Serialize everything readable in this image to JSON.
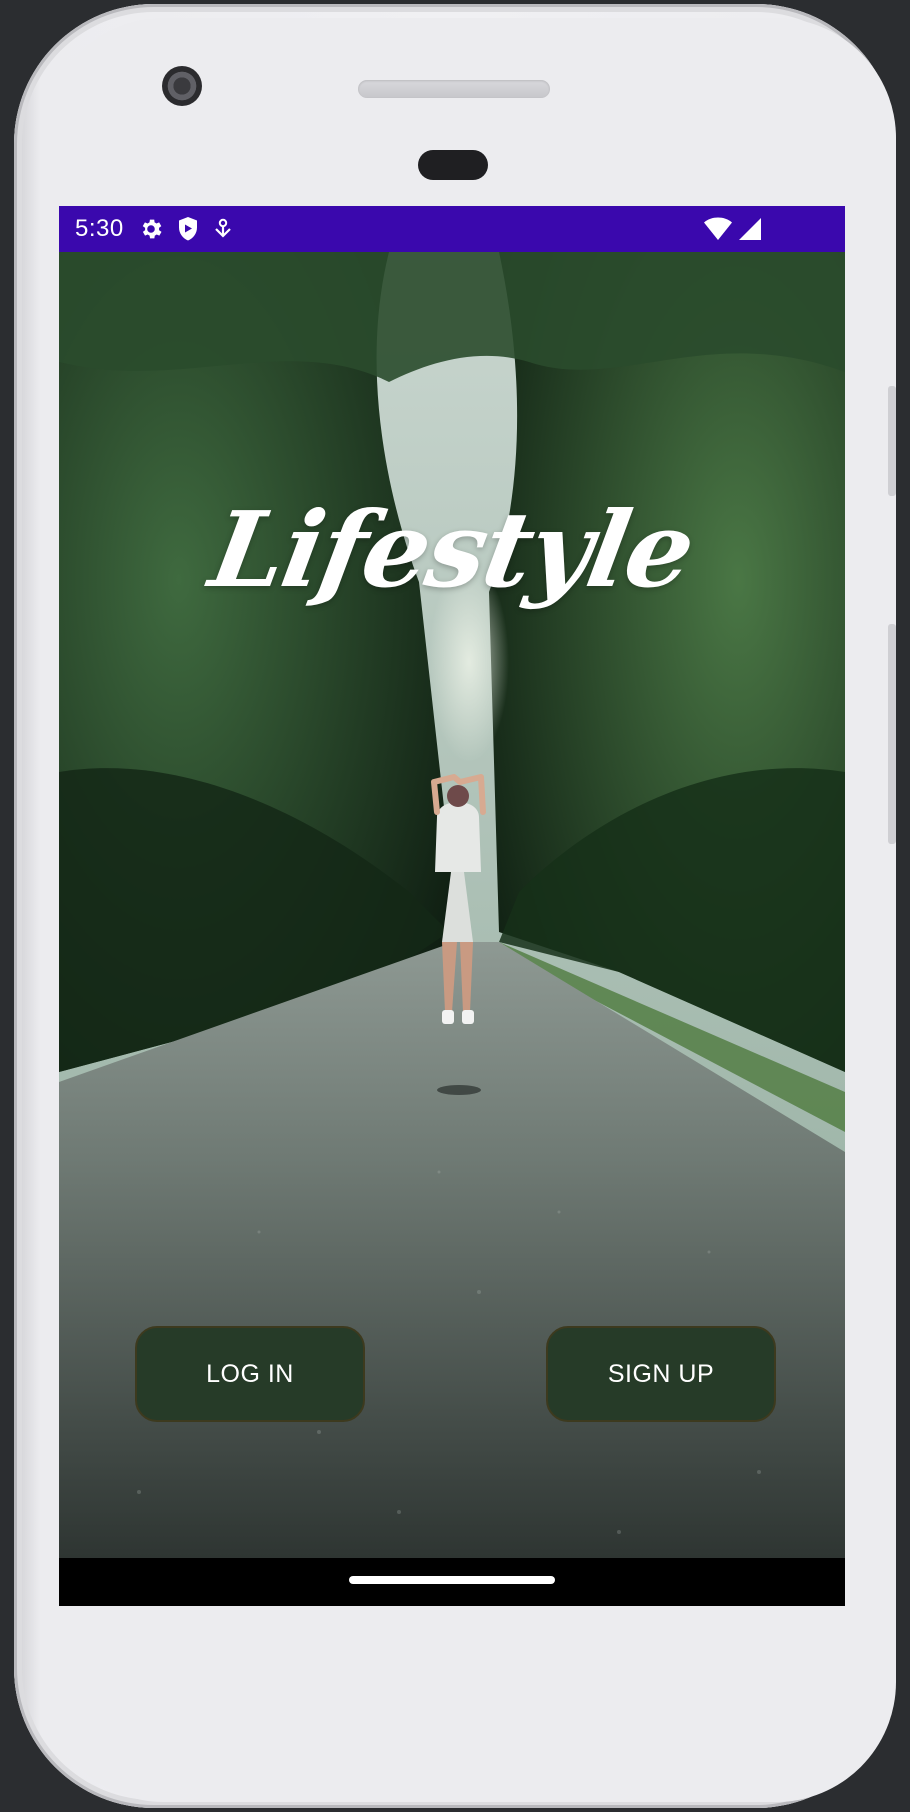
{
  "status_bar": {
    "time": "5:30",
    "background_color": "#3a08ad",
    "left_icons": [
      "gear-icon",
      "shield-icon",
      "download-icon"
    ],
    "right_icons": [
      "wifi-icon",
      "cellular-signal-icon"
    ]
  },
  "app": {
    "title": "Lifestyle",
    "background_image": "person-walking-on-forest-road-photo"
  },
  "buttons": {
    "login_label": "LOG IN",
    "signup_label": "SIGN UP",
    "color": "#263b28"
  },
  "nav_bar": {
    "home_indicator": "home-pill"
  }
}
